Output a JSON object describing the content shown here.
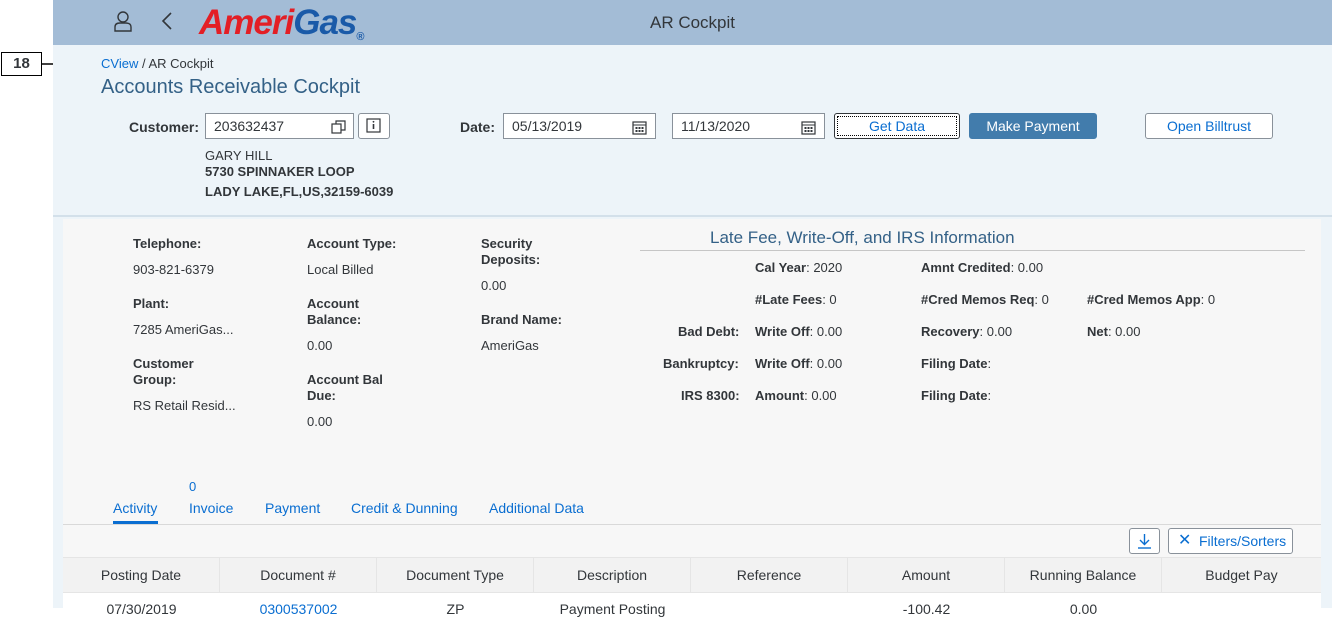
{
  "annotation": {
    "number": "18"
  },
  "shell": {
    "title": "AR Cockpit",
    "logo_ameri": "Ameri",
    "logo_gas": "Gas",
    "logo_reg": "®"
  },
  "breadcrumb": {
    "link": "CView",
    "separator": " / ",
    "current": "AR Cockpit"
  },
  "page_title": "Accounts Receivable Cockpit",
  "filter": {
    "customer_label": "Customer:",
    "customer_value": "203632437",
    "date_label": "Date:",
    "date_from": "05/13/2019",
    "date_to": "11/13/2020",
    "get_data": "Get Data",
    "make_payment": "Make Payment",
    "open_billtrust": "Open Billtrust"
  },
  "customer": {
    "name": "GARY HILL",
    "street": "5730 SPINNAKER LOOP",
    "city": "LADY LAKE,FL,US,32159-6039"
  },
  "account": {
    "telephone_label": "Telephone:",
    "telephone": "903-821-6379",
    "plant_label": "Plant:",
    "plant": "7285 AmeriGas...",
    "customer_group_label_1": "Customer",
    "customer_group_label_2": "Group:",
    "customer_group": "RS Retail Resid...",
    "account_type_label": "Account Type:",
    "account_type": "Local Billed",
    "account_balance_label_1": "Account",
    "account_balance_label_2": "Balance:",
    "account_balance": "0.00",
    "account_bal_due_label_1": "Account Bal",
    "account_bal_due_label_2": "Due:",
    "account_bal_due": "0.00",
    "security_deposits_label_1": "Security",
    "security_deposits_label_2": "Deposits:",
    "security_deposits": "0.00",
    "brand_name_label": "Brand Name:",
    "brand_name": "AmeriGas"
  },
  "late_fee": {
    "title": "Late Fee, Write-Off, and IRS Information",
    "cal_year_label": "Cal Year",
    "cal_year": ": 2020",
    "amnt_credited_label": "Amnt Credited",
    "amnt_credited": ": 0.00",
    "late_fees_label": "#Late Fees",
    "late_fees": ": 0",
    "cred_memos_req_label": "#Cred Memos Req",
    "cred_memos_req": ": 0",
    "cred_memos_app_label": "#Cred Memos App",
    "cred_memos_app": ": 0",
    "bad_debt_label": "Bad Debt:",
    "bad_debt_writeoff_label": "Write Off",
    "bad_debt_writeoff": ": 0.00",
    "recovery_label": "Recovery",
    "recovery": ": 0.00",
    "net_label": "Net",
    "net": ": 0.00",
    "bankruptcy_label": "Bankruptcy:",
    "bankruptcy_writeoff_label": "Write Off",
    "bankruptcy_writeoff": ": 0.00",
    "filing_date_label_1": "Filing Date",
    "filing_date_1": ":",
    "irs_label": "IRS 8300:",
    "irs_amount_label": "Amount",
    "irs_amount": ": 0.00",
    "filing_date_label_2": "Filing Date",
    "filing_date_2": ":"
  },
  "tabs": {
    "invoice_count": "0",
    "activity": "Activity",
    "invoice": "Invoice",
    "payment": "Payment",
    "credit_dunning": "Credit & Dunning",
    "additional_data": "Additional Data",
    "filters_sorters": "Filters/Sorters"
  },
  "table": {
    "columns": [
      "Posting Date",
      "Document #",
      "Document Type",
      "Description",
      "Reference",
      "Amount",
      "Running Balance",
      "Budget Pay"
    ],
    "row1": [
      "07/30/2019",
      "0300537002",
      "ZP",
      "Payment Posting",
      "",
      "-100.42",
      "0.00",
      ""
    ]
  },
  "colors": {
    "shell": "#a3bcd6",
    "accent": "#0a6ed1",
    "primary_button": "#427cac",
    "logo_red": "#e31e25",
    "logo_blue": "#1a5aa8"
  }
}
